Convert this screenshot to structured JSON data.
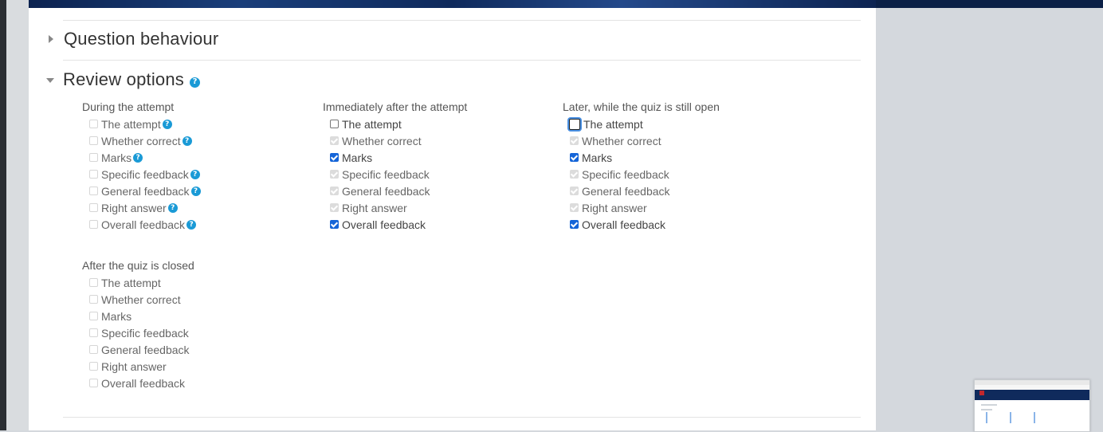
{
  "sections": {
    "question_behaviour": {
      "title": "Question behaviour",
      "expanded": false
    },
    "review_options": {
      "title": "Review options",
      "expanded": true,
      "help": "?"
    }
  },
  "groups": [
    {
      "title": "During the attempt",
      "options": [
        {
          "label": "The attempt",
          "state": "disabled",
          "help": true
        },
        {
          "label": "Whether correct",
          "state": "disabled",
          "help": true
        },
        {
          "label": "Marks",
          "state": "disabled",
          "help": true
        },
        {
          "label": "Specific feedback",
          "state": "disabled",
          "help": true
        },
        {
          "label": "General feedback",
          "state": "disabled",
          "help": true
        },
        {
          "label": "Right answer",
          "state": "disabled",
          "help": true
        },
        {
          "label": "Overall feedback",
          "state": "disabled",
          "help": true
        }
      ]
    },
    {
      "title": "Immediately after the attempt",
      "options": [
        {
          "label": "The attempt",
          "state": "unchecked",
          "help": false
        },
        {
          "label": "Whether correct",
          "state": "disabled-checked",
          "help": false
        },
        {
          "label": "Marks",
          "state": "checked",
          "help": false
        },
        {
          "label": "Specific feedback",
          "state": "disabled-checked",
          "help": false
        },
        {
          "label": "General feedback",
          "state": "disabled-checked",
          "help": false
        },
        {
          "label": "Right answer",
          "state": "disabled-checked",
          "help": false
        },
        {
          "label": "Overall feedback",
          "state": "checked",
          "help": false
        }
      ]
    },
    {
      "title": "Later, while the quiz is still open",
      "options": [
        {
          "label": "The attempt",
          "state": "focused",
          "help": false
        },
        {
          "label": "Whether correct",
          "state": "disabled-checked",
          "help": false
        },
        {
          "label": "Marks",
          "state": "checked",
          "help": false
        },
        {
          "label": "Specific feedback",
          "state": "disabled-checked",
          "help": false
        },
        {
          "label": "General feedback",
          "state": "disabled-checked",
          "help": false
        },
        {
          "label": "Right answer",
          "state": "disabled-checked",
          "help": false
        },
        {
          "label": "Overall feedback",
          "state": "checked",
          "help": false
        }
      ]
    },
    {
      "title": "After the quiz is closed",
      "options": [
        {
          "label": "The attempt",
          "state": "disabled",
          "help": false
        },
        {
          "label": "Whether correct",
          "state": "disabled",
          "help": false
        },
        {
          "label": "Marks",
          "state": "disabled",
          "help": false
        },
        {
          "label": "Specific feedback",
          "state": "disabled",
          "help": false
        },
        {
          "label": "General feedback",
          "state": "disabled",
          "help": false
        },
        {
          "label": "Right answer",
          "state": "disabled",
          "help": false
        },
        {
          "label": "Overall feedback",
          "state": "disabled",
          "help": false
        }
      ]
    }
  ],
  "colors": {
    "accent": "#1565d8",
    "help_icon": "#1a9ad6",
    "banner": "#0f2a5c"
  }
}
